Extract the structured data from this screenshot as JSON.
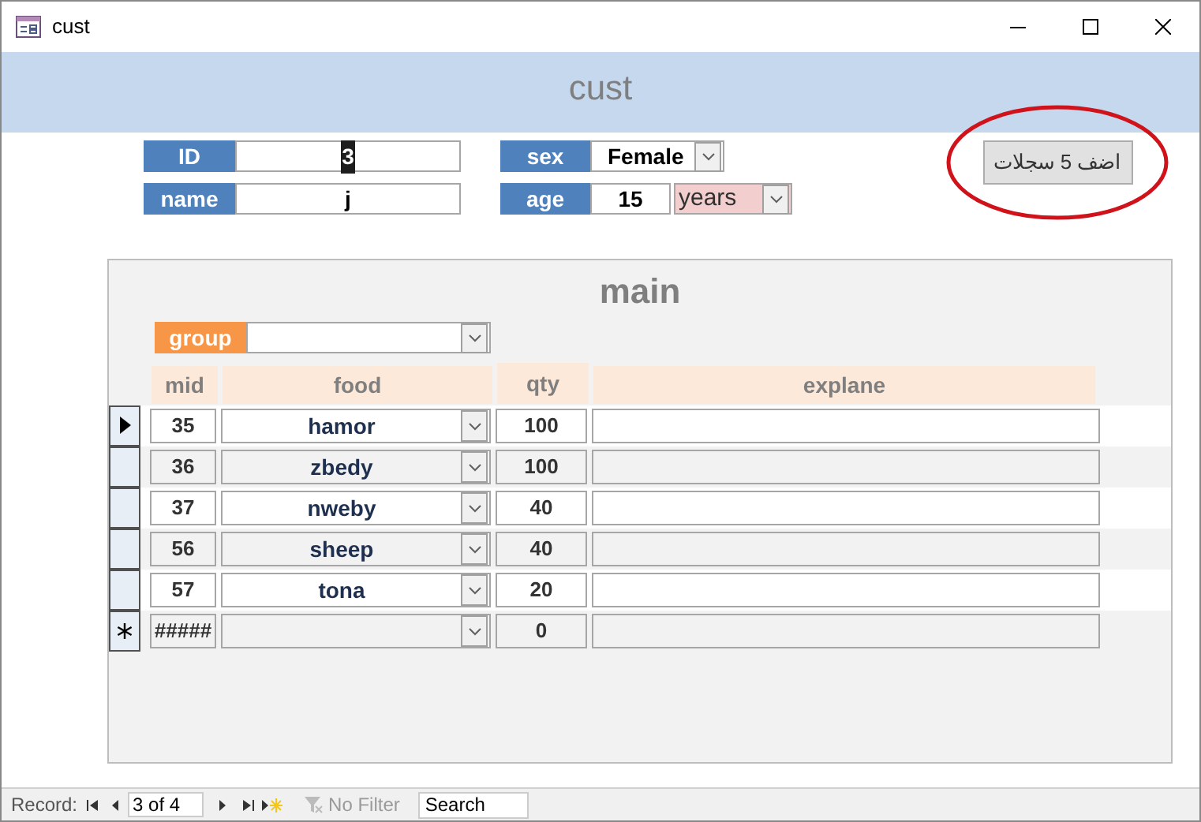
{
  "window": {
    "title": "cust"
  },
  "header": {
    "title": "cust"
  },
  "fields_left": [
    {
      "label": "ID",
      "value": "3",
      "selected": true
    },
    {
      "label": "name",
      "value": "j",
      "selected": false
    }
  ],
  "sex": {
    "label": "sex",
    "value": "Female"
  },
  "age": {
    "label": "age",
    "value": "15",
    "unit": "years"
  },
  "action_button": {
    "label": "اضف 5 سجلات",
    "highlighted": true
  },
  "subform": {
    "title": "main",
    "group_label": "group",
    "columns": [
      "mid",
      "food",
      "qty",
      "explane"
    ],
    "rows": [
      {
        "kind": "record",
        "current": true,
        "mid": "35",
        "food": "hamor",
        "qty": "100"
      },
      {
        "kind": "record",
        "current": false,
        "mid": "36",
        "food": "zbedy",
        "qty": "100"
      },
      {
        "kind": "record",
        "current": false,
        "mid": "37",
        "food": "nweby",
        "qty": "40"
      },
      {
        "kind": "record",
        "current": false,
        "mid": "56",
        "food": "sheep",
        "qty": "40"
      },
      {
        "kind": "record",
        "current": false,
        "mid": "57",
        "food": "tona",
        "qty": "20"
      },
      {
        "kind": "new",
        "mid": "#####",
        "qty": "0"
      }
    ]
  },
  "status_bar": {
    "label": "Record:",
    "position": "3 of 4",
    "filter": "No Filter",
    "search": "Search"
  }
}
